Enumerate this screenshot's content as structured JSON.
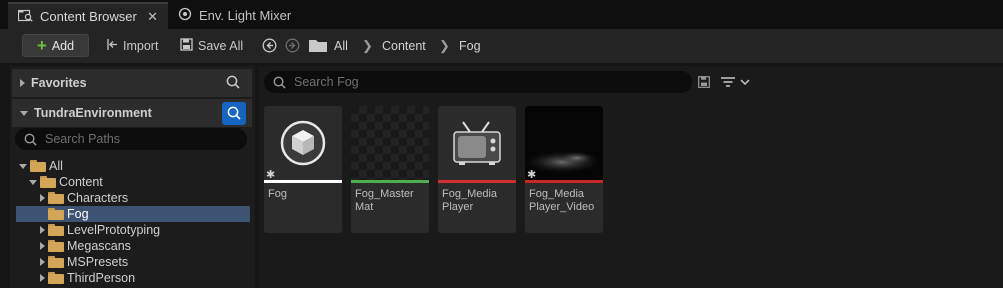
{
  "tabs": [
    {
      "label": "Content Browser",
      "active": true,
      "icon": "content-browser-icon"
    },
    {
      "label": "Env. Light Mixer",
      "active": false,
      "icon": "light-mixer-icon"
    }
  ],
  "toolbar": {
    "add_label": "Add",
    "import_label": "Import",
    "save_all_label": "Save All",
    "breadcrumb": [
      "All",
      "Content",
      "Fog"
    ]
  },
  "sidebar": {
    "favorites_label": "Favorites",
    "project_label": "TundraEnvironment",
    "search_placeholder": "Search Paths",
    "tree": [
      {
        "label": "All"
      },
      {
        "label": "Content"
      },
      {
        "label": "Characters"
      },
      {
        "label": "Fog"
      },
      {
        "label": "LevelPrototyping"
      },
      {
        "label": "Megascans"
      },
      {
        "label": "MSPresets"
      },
      {
        "label": "ThirdPerson"
      }
    ]
  },
  "content": {
    "search_placeholder": "Search Fog",
    "assets": [
      {
        "name": "Fog",
        "color": "#ffffff"
      },
      {
        "name": "Fog_Master\nMat",
        "color": "#4caf50"
      },
      {
        "name": "Fog_Media\nPlayer",
        "color": "#d32f2f"
      },
      {
        "name": "Fog_Media\nPlayer_Video",
        "color": "#c62828"
      }
    ]
  },
  "colors": {
    "accent": "#1565c0",
    "selection": "#3e5272",
    "folder": "#d3a557"
  }
}
